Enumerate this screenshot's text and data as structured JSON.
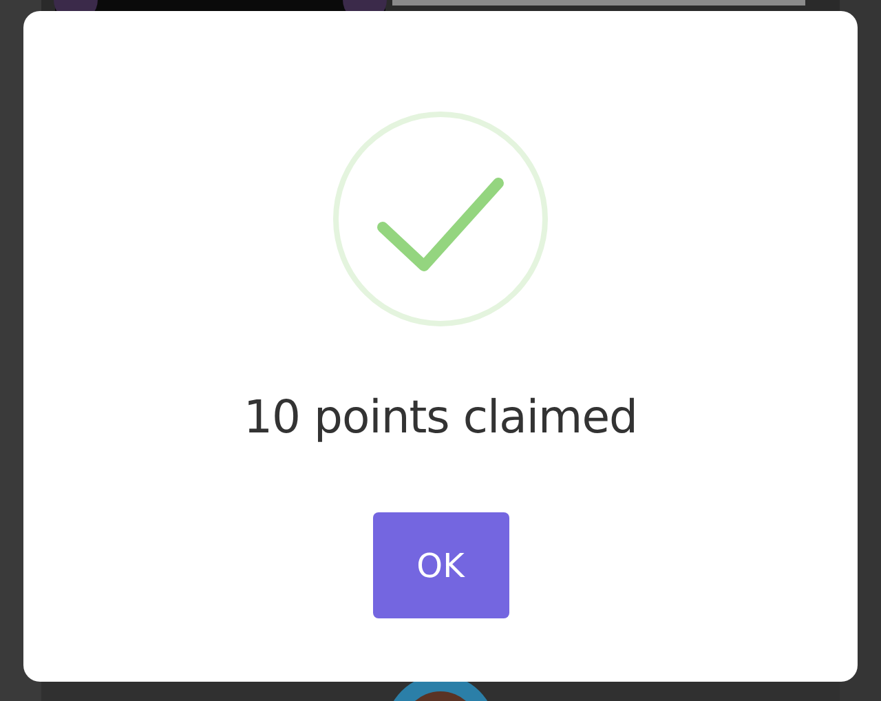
{
  "dialog": {
    "success": true,
    "message": "10 points claimed",
    "buttons": [
      "OK"
    ]
  }
}
